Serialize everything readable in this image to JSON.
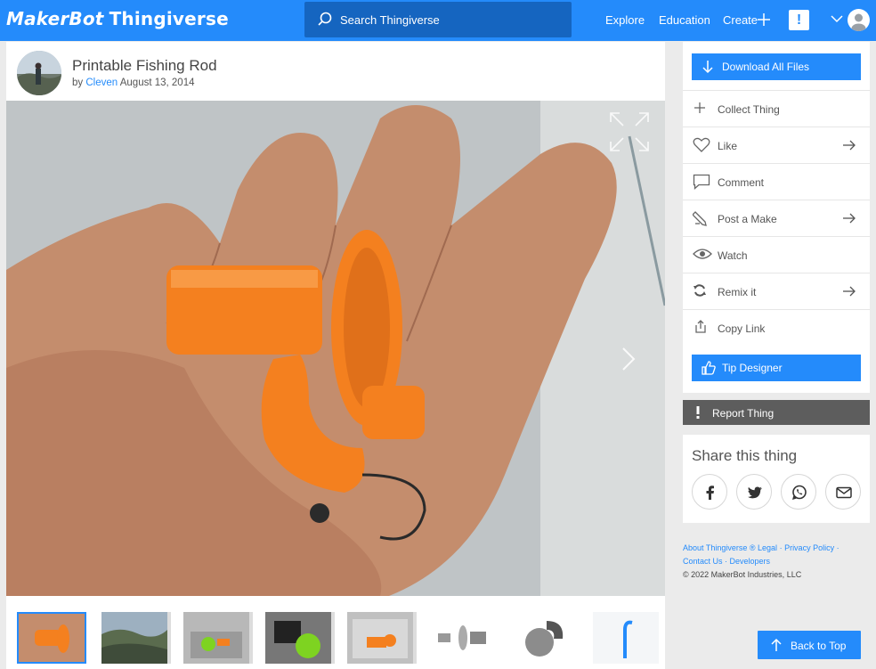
{
  "brand": {
    "makerbot": "MakerBot",
    "thingiverse": "Thingiverse"
  },
  "search": {
    "placeholder": "Search Thingiverse"
  },
  "nav": {
    "explore": "Explore",
    "education": "Education",
    "create": "Create",
    "notification": "!"
  },
  "thing": {
    "title": "Printable Fishing Rod",
    "by": "by",
    "author": "Cleven",
    "date": "August 13, 2014"
  },
  "actions": {
    "download": "Download All Files",
    "collect": "Collect Thing",
    "like": "Like",
    "comment": "Comment",
    "post_make": "Post a Make",
    "watch": "Watch",
    "remix": "Remix it",
    "copy_link": "Copy Link",
    "tip": "Tip Designer"
  },
  "report": "Report Thing",
  "share": {
    "title": "Share this thing",
    "targets": [
      "facebook-icon",
      "twitter-icon",
      "whatsapp-icon",
      "email-icon"
    ]
  },
  "footer": {
    "about": "About Thingiverse",
    "sep1": " ® ",
    "legal": "Legal",
    "sep2": " · ",
    "privacy": "Privacy Policy",
    "sep3": " · ",
    "contact": "Contact Us",
    "sep4": " · ",
    "developers": "Developers",
    "copyright": "© 2022 MakerBot Industries, LLC"
  },
  "back_to_top": "Back to Top",
  "colors": {
    "brand_blue": "#248bfb",
    "search_bg": "#1565c0",
    "report_bg": "#5d5d5d",
    "print_orange": "#f4801f"
  }
}
